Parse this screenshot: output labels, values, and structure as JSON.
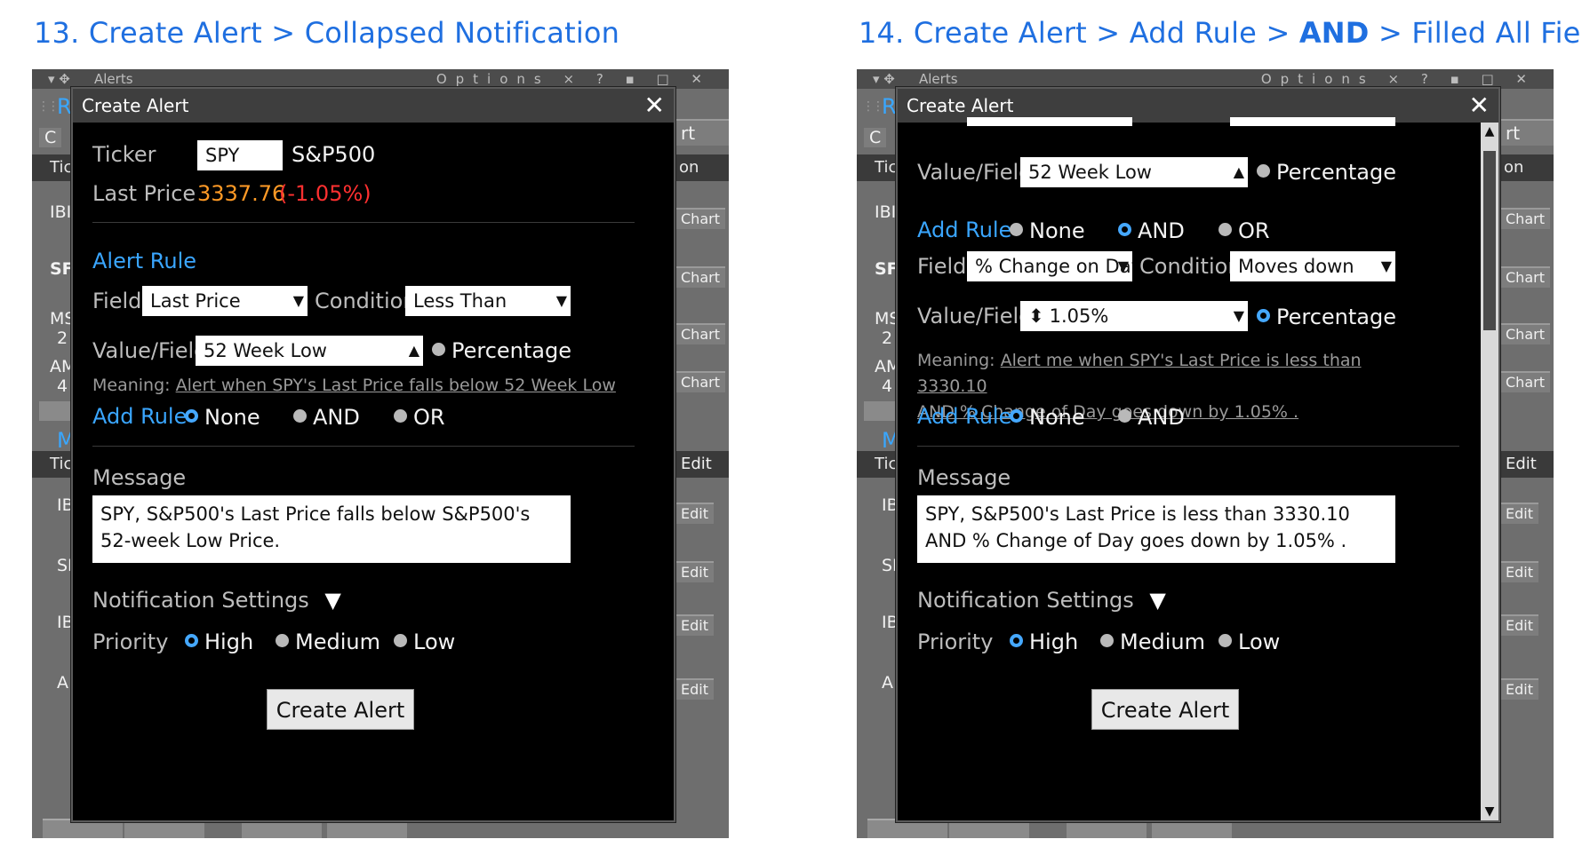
{
  "panels": [
    {
      "heading_prefix": "13. Create Alert > Collapsed Notification",
      "bg": {
        "window_title": "Alerts",
        "options": "Options ×",
        "controls": "? ▪ □ ✕",
        "right_buttons": [
          "rt",
          "Chart",
          "Chart",
          "Chart",
          "Chart",
          "Edit",
          "Edit",
          "Edit",
          "Edit",
          "Edit"
        ],
        "header_on": "on",
        "left_labels": [
          "R",
          "C",
          "Tic",
          "IBI",
          "SF",
          "MS",
          "2",
          "AM",
          "4",
          "M",
          "Tic",
          "IB",
          "SI",
          "IB",
          "A"
        ]
      },
      "dialog": {
        "title": "Create Alert",
        "close": "✕",
        "ticker_label": "Ticker",
        "ticker_value": "SPY",
        "ticker_name": "S&P500",
        "last_price_label": "Last Price",
        "last_price": "3337.76",
        "last_change": "(-1.05%)",
        "alert_rule_heading": "Alert Rule",
        "field_label": "Field",
        "field_value": "Last Price",
        "condition_label": "Condition",
        "condition_value": "Less Than",
        "value_field_label": "Value/Field",
        "value_field_value": "52 Week Low",
        "percentage_label": "Percentage",
        "meaning_prefix": "Meaning:",
        "meaning_text": "Alert when SPY's Last Price falls below 52 Week Low",
        "add_rule_label": "Add Rule",
        "add_rule_options": [
          "None",
          "AND",
          "OR"
        ],
        "message_label": "Message",
        "message_text": "SPY, S&P500's Last Price falls below S&P500's 52-week Low Price.",
        "notification_label": "Notification Settings",
        "priority_label": "Priority",
        "priority_options": [
          "High",
          "Medium",
          "Low"
        ],
        "create_button": "Create Alert"
      }
    },
    {
      "heading_prefix": "14. Create Alert > Add Rule >",
      "heading_bold": "AND",
      "heading_suffix": "> Filled All Fields",
      "bg": {
        "window_title": "Alerts",
        "options": "Options ×",
        "controls": "? ▪ □ ✕",
        "right_buttons": [
          "rt",
          "Chart",
          "Chart",
          "Chart",
          "Chart",
          "Edit",
          "Edit",
          "Edit",
          "Edit",
          "Edit"
        ],
        "header_on": "on",
        "left_labels": [
          "R",
          "C",
          "Tic",
          "IBI",
          "SF",
          "MS",
          "2",
          "AM",
          "4",
          "M",
          "Tic",
          "IB",
          "SI",
          "IB",
          "A"
        ]
      },
      "dialog": {
        "title": "Create Alert",
        "close": "✕",
        "value_field_label": "Value/Field",
        "value_field_value": "52 Week Low",
        "percentage_label": "Percentage",
        "add_rule_label": "Add Rule",
        "add_rule_options": [
          "None",
          "AND",
          "OR"
        ],
        "field_label": "Field",
        "field_value": "% Change on Day",
        "condition_label": "Condition",
        "condition_value": "Moves down",
        "value2_label": "Value/Field",
        "value2_value": "1.05%",
        "percentage2_label": "Percentage",
        "meaning_prefix": "Meaning:",
        "meaning_line1": "Alert me when SPY's Last Price is less than 3330.10",
        "meaning_line2": "AND % Change of Day goes down by 1.05% .",
        "add_rule2_label": "Add Rule",
        "add_rule2_options": [
          "None",
          "AND"
        ],
        "message_label": "Message",
        "message_text": "SPY, S&P500's Last Price is less than 3330.10 AND % Change of Day goes down by 1.05% .",
        "notification_label": "Notification Settings",
        "priority_label": "Priority",
        "priority_options": [
          "High",
          "Medium",
          "Low"
        ],
        "create_button": "Create Alert"
      }
    }
  ],
  "colors": {
    "heading_blue": "#1f6fe0",
    "label_blue": "#3aa6ff",
    "price_orange": "#ff9a26",
    "change_red": "#ff3030",
    "radio_selected": "#45a8ff"
  }
}
